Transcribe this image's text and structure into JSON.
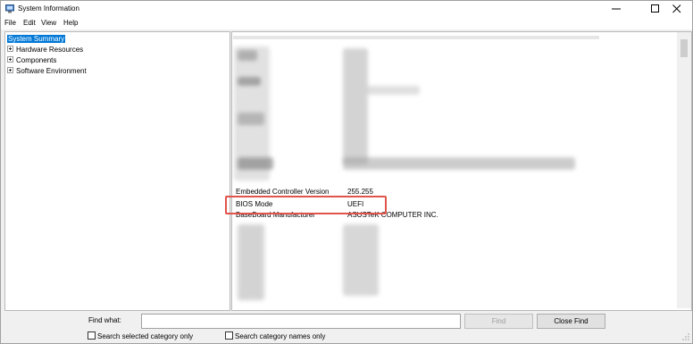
{
  "window": {
    "title": "System Information"
  },
  "menu": [
    "File",
    "Edit",
    "View",
    "Help"
  ],
  "tree": {
    "items": [
      {
        "label": "System Summary",
        "selected": true,
        "expandable": false
      },
      {
        "label": "Hardware Resources",
        "selected": false,
        "expandable": true
      },
      {
        "label": "Components",
        "selected": false,
        "expandable": true
      },
      {
        "label": "Software Environment",
        "selected": false,
        "expandable": true
      }
    ]
  },
  "details": {
    "rows": [
      {
        "item": "Embedded Controller Version",
        "value": "255.255"
      },
      {
        "item": "BIOS Mode",
        "value": "UEFI"
      },
      {
        "item": "BaseBoard Manufacturer",
        "value": "ASUSTeK COMPUTER INC."
      }
    ],
    "highlight_color": "#e0544c"
  },
  "find_bar": {
    "label": "Find what:",
    "input_value": "",
    "find_button": "Find",
    "close_button": "Close Find",
    "check_selected_category": "Search selected category only",
    "check_category_names": "Search category names only"
  },
  "colors": {
    "selection": "#0078d7",
    "annotation": "#e0544c"
  }
}
